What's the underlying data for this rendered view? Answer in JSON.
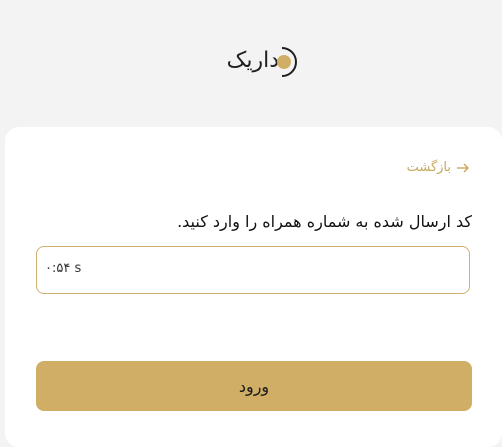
{
  "logo": {
    "text": "داریک",
    "icon": "brand-mark-icon",
    "mark_color": "#d0ae66"
  },
  "back": {
    "label": "بازگشت",
    "icon": "arrow-right-icon"
  },
  "prompt": {
    "text": "کد ارسال شده به شماره همراه را وارد کنید."
  },
  "code_input": {
    "value": "",
    "timer": "۰:۵۴ s"
  },
  "submit": {
    "label": "ورود"
  },
  "colors": {
    "accent": "#d0ae66",
    "accent_text": "#c9a85c",
    "input_border": "#cfb071",
    "page_background": "#f3f3f3",
    "card_background": "#ffffff"
  }
}
